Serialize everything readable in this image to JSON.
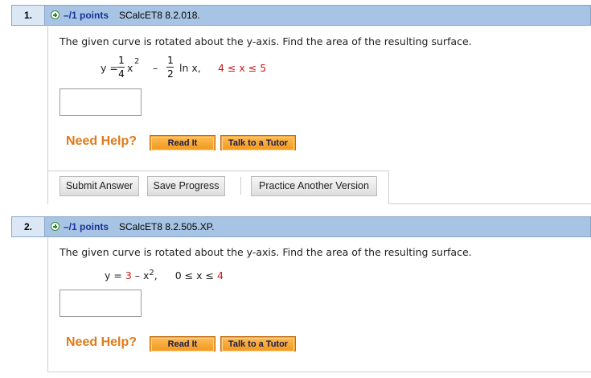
{
  "questions": [
    {
      "number": "1.",
      "points": "–/1 points",
      "ref": "SCalcET8 8.2.018.",
      "prompt": "The given curve is rotated about the y-axis. Find the area of the resulting surface.",
      "equation": {
        "lhs": "y =",
        "frac1_num": "1",
        "frac1_den": "4",
        "term1": "x",
        "term1_exp": "2",
        "minus": "–",
        "frac2_num": "1",
        "frac2_den": "2",
        "term2": "ln x,",
        "range": "4 ≤ x ≤ 5"
      },
      "need_help": "Need Help?",
      "read_it": "Read It",
      "talk_tutor": "Talk to a Tutor",
      "submit": "Submit Answer",
      "save": "Save Progress",
      "practice": "Practice Another Version"
    },
    {
      "number": "2.",
      "points": "–/1 points",
      "ref": "SCalcET8 8.2.505.XP.",
      "prompt": "The given curve is rotated about the y-axis. Find the area of the resulting surface.",
      "equation": {
        "lhs": "y = ",
        "three": "3",
        "rest": " – x",
        "exp": "2",
        "comma": ",",
        "range_a": "0 ≤ x ≤ ",
        "range_b": "4"
      },
      "need_help": "Need Help?",
      "read_it": "Read It",
      "talk_tutor": "Talk to a Tutor"
    }
  ],
  "colors": {
    "header_bg": "#a8c4e4",
    "points_blue": "#1a2f9a",
    "help_orange": "#e07a1a",
    "red_values": "#cc1a1a"
  },
  "icons": [
    "plus-icon"
  ]
}
